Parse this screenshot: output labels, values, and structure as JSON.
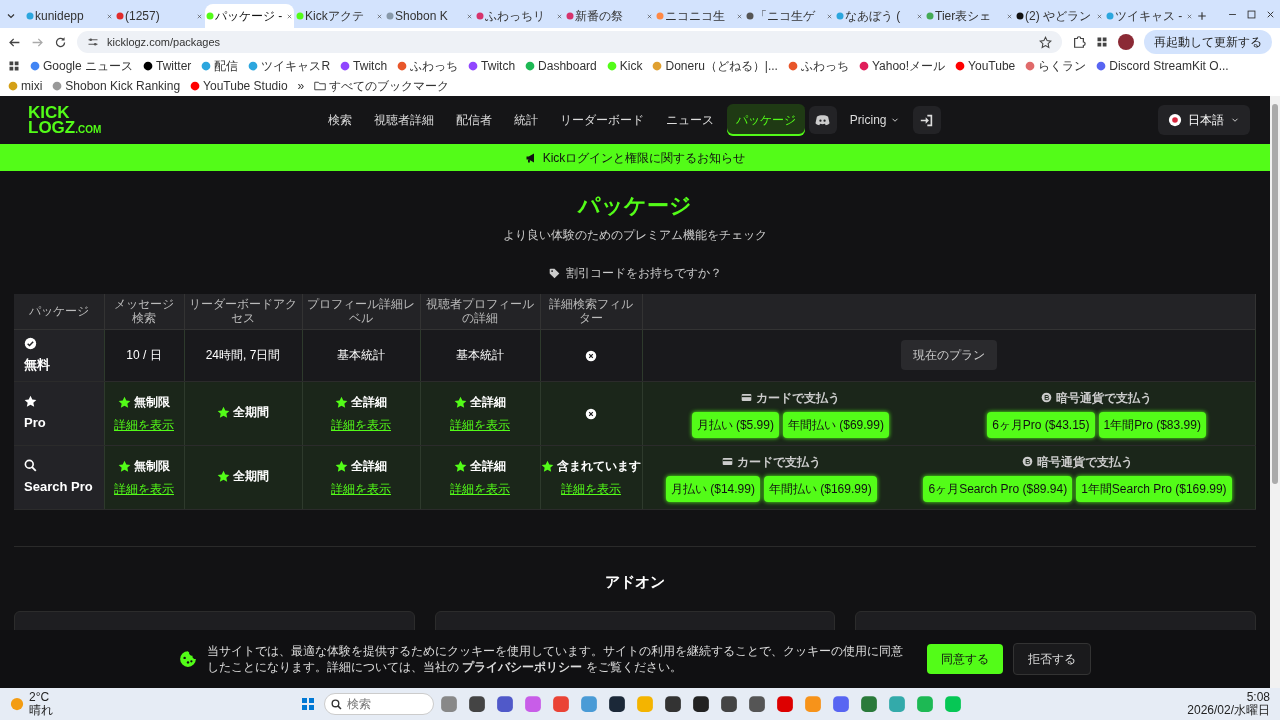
{
  "browser": {
    "tabs": [
      {
        "title": "kunidepp",
        "selected": false
      },
      {
        "title": "(1257)",
        "selected": false
      },
      {
        "title": "パッケージ -",
        "selected": true
      },
      {
        "title": "Kickアクテ",
        "selected": false
      },
      {
        "title": "Shobon K",
        "selected": false
      },
      {
        "title": "ふわっちリ",
        "selected": false
      },
      {
        "title": "新番の祭",
        "selected": false
      },
      {
        "title": "ニコニコ生",
        "selected": false
      },
      {
        "title": "「ニコ生ゲ",
        "selected": false
      },
      {
        "title": "なあぼう (",
        "selected": false
      },
      {
        "title": "Tier表シェ",
        "selected": false
      },
      {
        "title": "(2) やどラン",
        "selected": false
      },
      {
        "title": "ツイキャス -",
        "selected": false
      }
    ],
    "address": "kicklogz.com/packages",
    "update_button": "再起動して更新する",
    "bookmarks": [
      "Google ニュース",
      "Twitter",
      "配信",
      "ツイキャスR",
      "Twitch",
      "ふわっち",
      "Twitch",
      "Dashboard",
      "Kick",
      "Doneru（どねる）|...",
      "ふわっち",
      "Yahoo!メール",
      "YouTube",
      "らくラン",
      "Discord StreamKit O...",
      "mixi",
      "Shobon Kick Ranking",
      "YouTube Studio"
    ],
    "more_bookmarks": "»",
    "all_bookmarks": "すべてのブックマーク"
  },
  "site_nav": {
    "logo_top": "KICK",
    "logo_bottom": "LOGZ",
    "logo_suffix": ".COM",
    "items": [
      {
        "label": "検索",
        "selected": false
      },
      {
        "label": "視聴者詳細",
        "selected": false
      },
      {
        "label": "配信者",
        "selected": false
      },
      {
        "label": "統計",
        "selected": false
      },
      {
        "label": "リーダーボード",
        "selected": false
      },
      {
        "label": "ニュース",
        "selected": false
      },
      {
        "label": "パッケージ",
        "selected": true
      }
    ],
    "pricing": "Pricing",
    "language": "日本語"
  },
  "notice": "Kickログインと権限に関するお知らせ",
  "heading": "パッケージ",
  "subtitle": "より良い体験のためのプレミアム機能をチェック",
  "discount_link": "割引コードをお持ちですか？",
  "table": {
    "columns": [
      "パッケージ",
      "メッセージ検索",
      "リーダーボードアクセス",
      "プロフィール詳細レベル",
      "視聴者プロフィールの詳細",
      "詳細検索フィルター"
    ],
    "rows": [
      {
        "cells": [
          {
            "kind": "plan",
            "text": "無料"
          },
          {
            "kind": "text",
            "text": "10 / 日"
          },
          {
            "kind": "text",
            "text": "24時間, 7日間"
          },
          {
            "kind": "text",
            "text": "基本統計"
          },
          {
            "kind": "text",
            "text": "基本統計"
          },
          {
            "kind": "none"
          },
          {
            "kind": "current",
            "label": "現在のプラン"
          }
        ]
      },
      {
        "cells": [
          {
            "kind": "plan",
            "text": "Pro"
          },
          {
            "kind": "feature",
            "text": "無制限",
            "link": "詳細を表示"
          },
          {
            "kind": "feature",
            "text": "全期間"
          },
          {
            "kind": "feature",
            "text": "全詳細",
            "link": "詳細を表示"
          },
          {
            "kind": "feature",
            "text": "全詳細",
            "link": "詳細を表示"
          },
          {
            "kind": "none"
          },
          {
            "kind": "payment",
            "groups": [
              {
                "kind": "card",
                "label": "カードで支払う",
                "buttons": [
                  "月払い ($5.99)",
                  "年間払い ($69.99)"
                ]
              },
              {
                "kind": "crypto",
                "label": "暗号通貨で支払う",
                "buttons": [
                  "6ヶ月Pro ($43.15)",
                  "1年間Pro ($83.99)"
                ]
              }
            ]
          }
        ]
      },
      {
        "cells": [
          {
            "kind": "plan",
            "text": "Search Pro"
          },
          {
            "kind": "feature",
            "text": "無制限",
            "link": "詳細を表示"
          },
          {
            "kind": "feature",
            "text": "全期間"
          },
          {
            "kind": "feature",
            "text": "全詳細",
            "link": "詳細を表示"
          },
          {
            "kind": "feature",
            "text": "全詳細",
            "link": "詳細を表示"
          },
          {
            "kind": "feature",
            "text": "含まれています",
            "link": "詳細を表示"
          },
          {
            "kind": "payment",
            "groups": [
              {
                "kind": "card",
                "label": "カードで支払う",
                "buttons": [
                  "月払い ($14.99)",
                  "年間払い ($169.99)"
                ]
              },
              {
                "kind": "crypto",
                "label": "暗号通貨で支払う",
                "buttons": [
                  "6ヶ月Search Pro ($89.94)",
                  "1年間Search Pro ($169.99)"
                ]
              }
            ]
          }
        ]
      }
    ]
  },
  "addons": {
    "heading": "アドオン"
  },
  "cookie": {
    "text": "当サイトでは、最適な体験を提供するためにクッキーを使用しています。サイトの利用を継続することで、クッキーの使用に同意したことになります。詳細については、当社の",
    "link": "プライバシーポリシー",
    "text_end": "をご覧ください。",
    "accept": "同意する",
    "reject": "拒否する"
  },
  "taskbar": {
    "temperature": "2°C",
    "weather": "晴れ",
    "search_placeholder": "検索",
    "time": "5:08",
    "date": "2026/02/水曜日"
  }
}
